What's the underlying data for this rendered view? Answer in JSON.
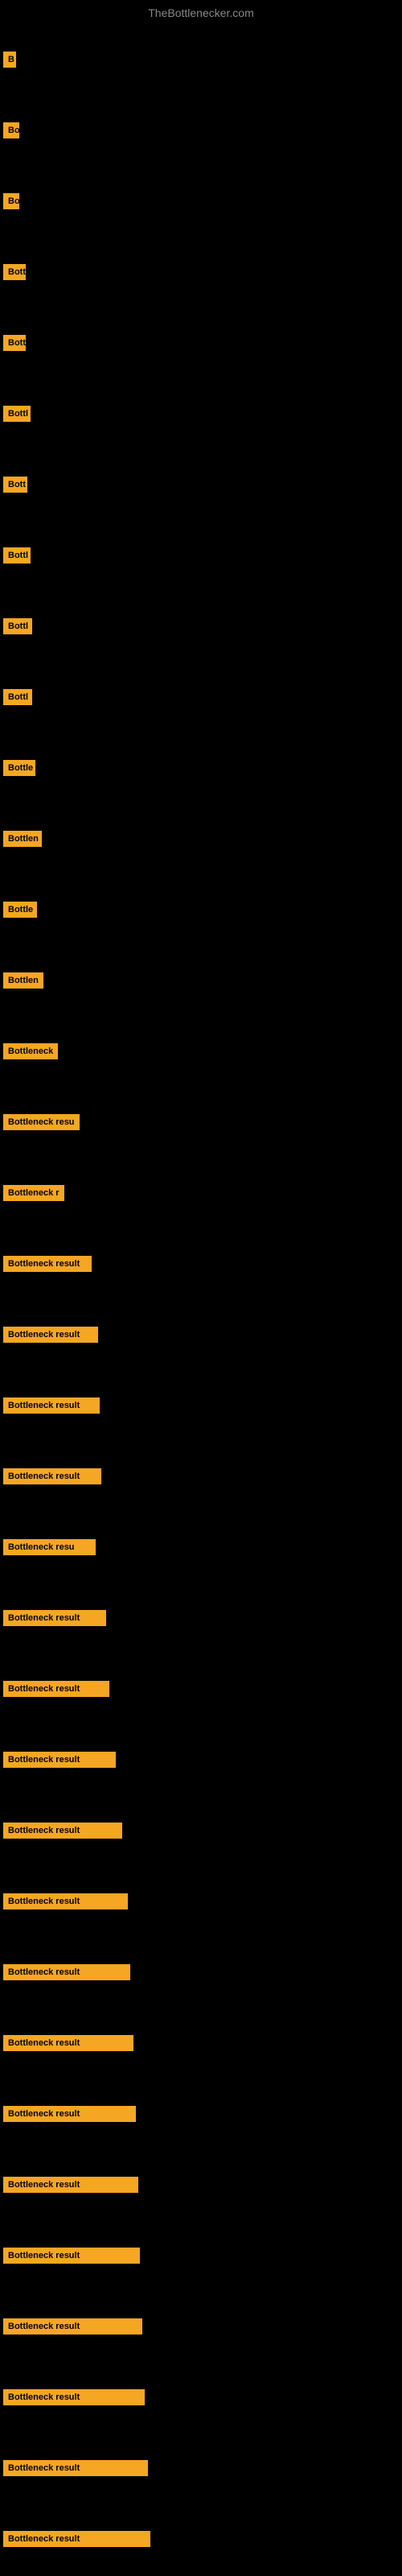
{
  "site_title": "TheBottlenecker.com",
  "items": [
    {
      "label": "B",
      "width": 16
    },
    {
      "label": "Bo",
      "width": 20
    },
    {
      "label": "Bo",
      "width": 20
    },
    {
      "label": "Bott",
      "width": 28
    },
    {
      "label": "Bott",
      "width": 28
    },
    {
      "label": "Bottl",
      "width": 34
    },
    {
      "label": "Bott",
      "width": 30
    },
    {
      "label": "Bottl",
      "width": 34
    },
    {
      "label": "Bottl",
      "width": 36
    },
    {
      "label": "Bottl",
      "width": 36
    },
    {
      "label": "Bottle",
      "width": 40
    },
    {
      "label": "Bottlen",
      "width": 48
    },
    {
      "label": "Bottle",
      "width": 42
    },
    {
      "label": "Bottlen",
      "width": 50
    },
    {
      "label": "Bottleneck",
      "width": 68
    },
    {
      "label": "Bottleneck resu",
      "width": 95
    },
    {
      "label": "Bottleneck r",
      "width": 76
    },
    {
      "label": "Bottleneck result",
      "width": 110
    },
    {
      "label": "Bottleneck result",
      "width": 118
    },
    {
      "label": "Bottleneck result",
      "width": 120
    },
    {
      "label": "Bottleneck result",
      "width": 122
    },
    {
      "label": "Bottleneck resu",
      "width": 115
    },
    {
      "label": "Bottleneck result",
      "width": 128
    },
    {
      "label": "Bottleneck result",
      "width": 132
    },
    {
      "label": "Bottleneck result",
      "width": 140
    },
    {
      "label": "Bottleneck result",
      "width": 148
    },
    {
      "label": "Bottleneck result",
      "width": 155
    },
    {
      "label": "Bottleneck result",
      "width": 158
    },
    {
      "label": "Bottleneck result",
      "width": 162
    },
    {
      "label": "Bottleneck result",
      "width": 165
    },
    {
      "label": "Bottleneck result",
      "width": 168
    },
    {
      "label": "Bottleneck result",
      "width": 170
    },
    {
      "label": "Bottleneck result",
      "width": 173
    },
    {
      "label": "Bottleneck result",
      "width": 176
    },
    {
      "label": "Bottleneck result",
      "width": 180
    },
    {
      "label": "Bottleneck result",
      "width": 183
    }
  ]
}
